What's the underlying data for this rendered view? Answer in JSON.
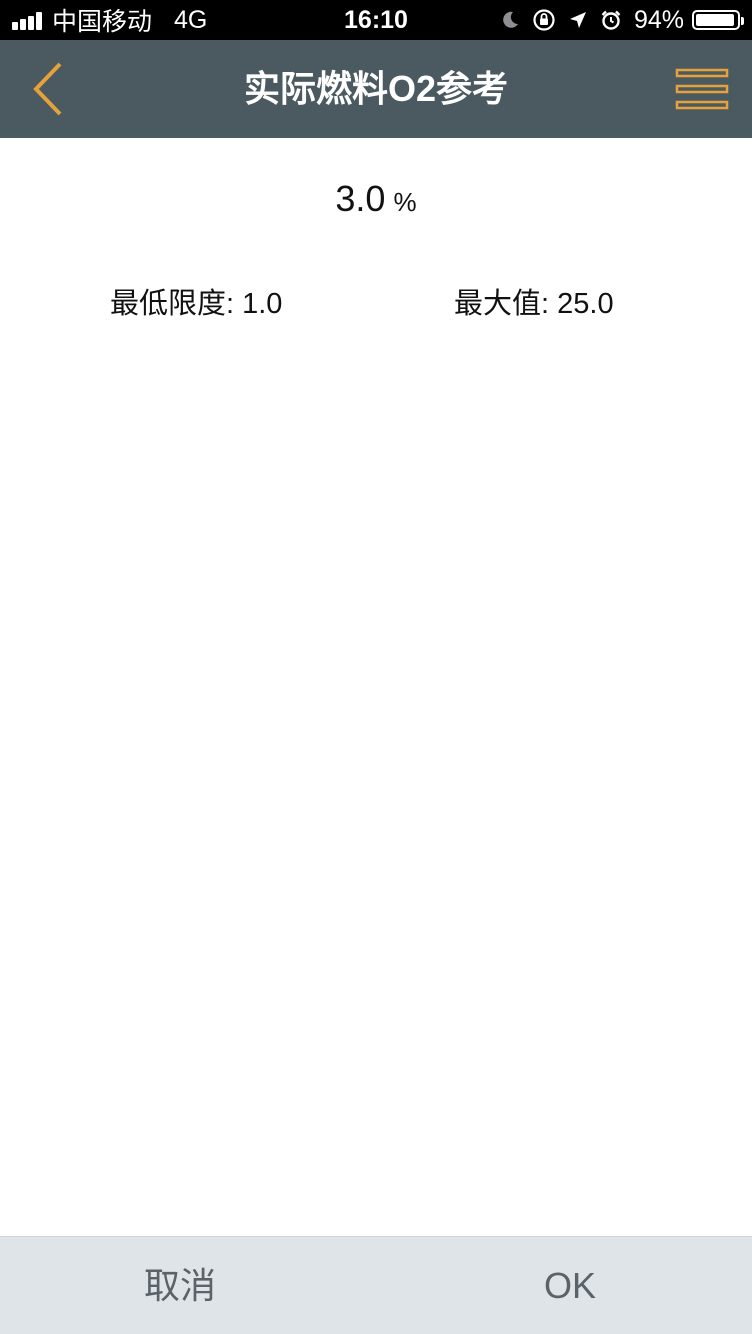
{
  "status_bar": {
    "carrier": "中国移动",
    "network": "4G",
    "time": "16:10",
    "battery_percent": "94%",
    "battery_level": 0.94,
    "icons": [
      "moon-icon",
      "orientation-lock-icon",
      "location-arrow-icon",
      "alarm-icon"
    ]
  },
  "nav": {
    "title": "实际燃料O2参考",
    "back_icon": "chevron-left-icon",
    "menu_icon": "hamburger-menu-icon",
    "accent_color": "#e5a13a",
    "background_color": "#4b5961"
  },
  "setting": {
    "value": "3.0",
    "unit": "%",
    "min_label": "最低限度:",
    "min_value": "1.0",
    "max_label": "最大值:",
    "max_value": "25.0"
  },
  "actions": {
    "cancel_label": "取消",
    "ok_label": "OK"
  }
}
